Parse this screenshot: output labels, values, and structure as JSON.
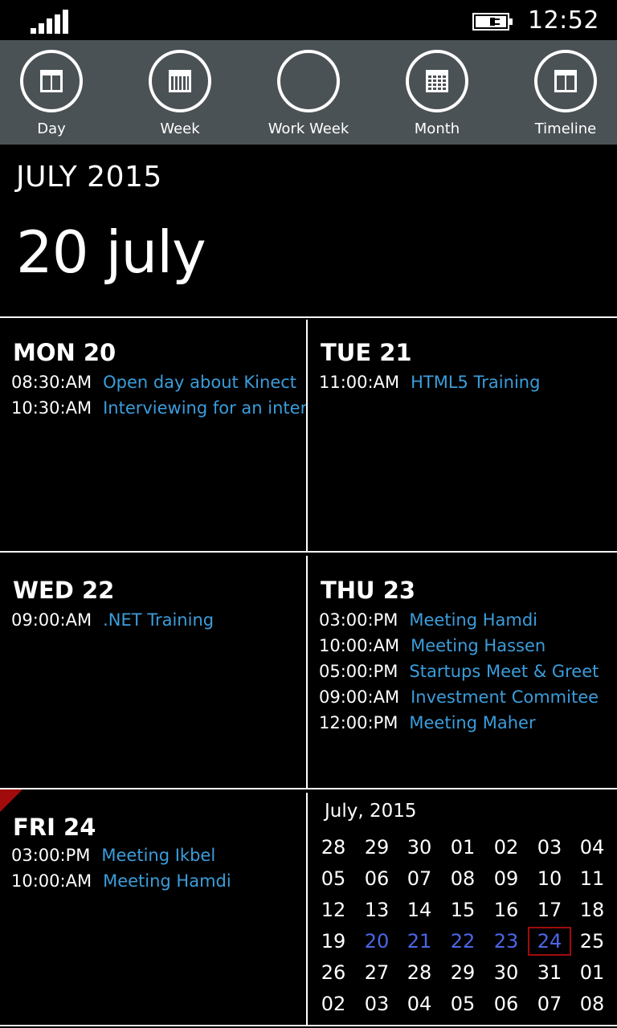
{
  "status_bar": {
    "time": "12:52"
  },
  "app_bar": {
    "buttons": [
      {
        "label": "Day",
        "icon": "day-view-icon"
      },
      {
        "label": "Week",
        "icon": "week-view-icon"
      },
      {
        "label": "Work Week",
        "icon": "work-week-view-icon"
      },
      {
        "label": "Month",
        "icon": "month-view-icon"
      },
      {
        "label": "Timeline",
        "icon": "timeline-view-icon"
      }
    ]
  },
  "header": {
    "month": "JULY 2015",
    "day": "20 july"
  },
  "days": [
    {
      "name": "MON 20",
      "events": [
        {
          "time": "08:30:AM",
          "title": "Open day about Kinect"
        },
        {
          "time": "10:30:AM",
          "title": "Interviewing for an internship"
        }
      ]
    },
    {
      "name": "TUE 21",
      "events": [
        {
          "time": "11:00:AM",
          "title": "HTML5 Training"
        }
      ]
    },
    {
      "name": "WED 22",
      "events": [
        {
          "time": "09:00:AM",
          "title": ".NET Training"
        }
      ]
    },
    {
      "name": "THU 23",
      "events": [
        {
          "time": "03:00:PM",
          "title": "Meeting Hamdi"
        },
        {
          "time": "10:00:AM",
          "title": "Meeting Hassen"
        },
        {
          "time": "05:00:PM",
          "title": "Startups Meet & Greet"
        },
        {
          "time": "09:00:AM",
          "title": "Investment Commitee"
        },
        {
          "time": "12:00:PM",
          "title": "Meeting Maher"
        }
      ]
    },
    {
      "name": "FRI 24",
      "events": [
        {
          "time": "03:00:PM",
          "title": "Meeting Ikbel"
        },
        {
          "time": "10:00:AM",
          "title": "Meeting Hamdi"
        }
      ]
    }
  ],
  "mini_calendar": {
    "title": "July, 2015",
    "weeks": [
      [
        "28",
        "29",
        "30",
        "01",
        "02",
        "03",
        "04"
      ],
      [
        "05",
        "06",
        "07",
        "08",
        "09",
        "10",
        "11"
      ],
      [
        "12",
        "13",
        "14",
        "15",
        "16",
        "17",
        "18"
      ],
      [
        "19",
        "20",
        "21",
        "22",
        "23",
        "24",
        "25"
      ],
      [
        "26",
        "27",
        "28",
        "29",
        "30",
        "31",
        "01"
      ],
      [
        "02",
        "03",
        "04",
        "05",
        "06",
        "07",
        "08"
      ]
    ],
    "highlighted_week_index": 3,
    "highlighted_days": [
      "20",
      "21",
      "22",
      "23",
      "24"
    ],
    "today": "24"
  },
  "colors": {
    "accent_event": "#3b9ddb",
    "highlight_week": "#4a66e8",
    "today_border": "#a20b0b",
    "app_bar": "#4b5255"
  }
}
